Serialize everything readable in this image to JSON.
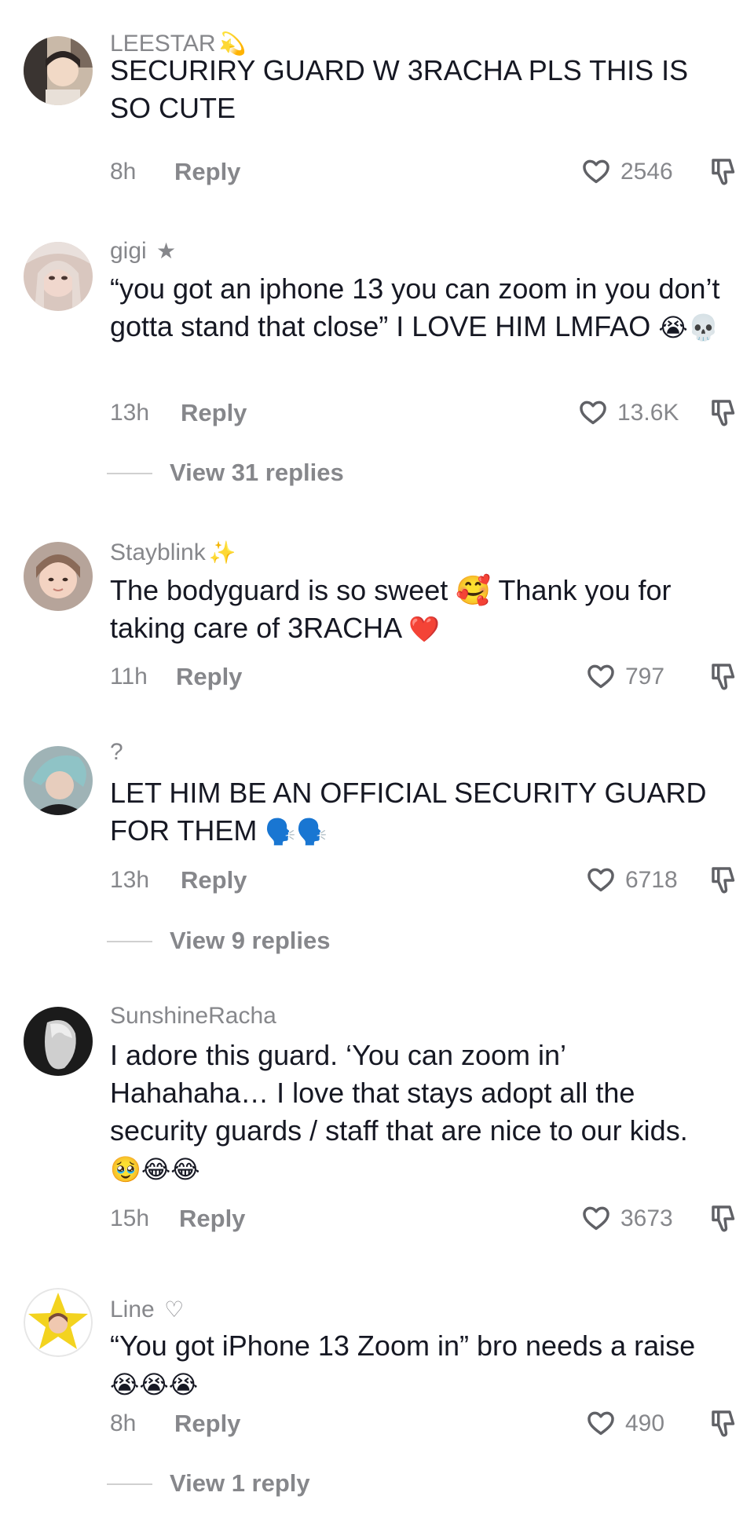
{
  "comments": [
    {
      "username": "LEESTAR",
      "username_deco": "💫",
      "text": "SECURIRY GUARD W 3RACHA PLS THIS IS SO CUTE",
      "time": "8h",
      "reply_label": "Reply",
      "likes": "2546"
    },
    {
      "username": "gigi",
      "username_deco": "★",
      "text": "“you got an iphone 13 you can zoom in you don’t gotta stand that close” I LOVE HIM LMFAO",
      "text_emoji": "😭💀",
      "time": "13h",
      "reply_label": "Reply",
      "likes": "13.6K",
      "view_replies": "View 31 replies"
    },
    {
      "username": "Stayblink",
      "username_deco": "✨",
      "text": "The bodyguard is so sweet 🥰 Thank you for taking care of 3RACHA",
      "text_emoji": "❤️",
      "time": "11h",
      "reply_label": "Reply",
      "likes": "797"
    },
    {
      "username": "?",
      "username_deco": "",
      "text": "LET HIM BE AN OFFICIAL SECURITY GUARD FOR THEM",
      "text_emoji": "🗣️🗣️",
      "time": "13h",
      "reply_label": "Reply",
      "likes": "6718",
      "view_replies": "View 9 replies"
    },
    {
      "username": "SunshineRacha",
      "username_deco": "",
      "text": "I adore this guard. ‘You can zoom in’ Hahahaha… I love that stays adopt all the security guards / staff that are nice to our kids.",
      "text_emoji": "🥹😂😂",
      "time": "15h",
      "reply_label": "Reply",
      "likes": "3673"
    },
    {
      "username": "Line",
      "username_deco": "♡",
      "text": "“You got iPhone 13 Zoom in” bro needs a raise",
      "text_emoji": "😭😭😭",
      "time": "8h",
      "reply_label": "Reply",
      "likes": "490",
      "view_replies": "View 1 reply"
    }
  ],
  "colors": {
    "text": "#161823",
    "secondary": "#86878b",
    "divider": "#d0d0d0",
    "heart_stroke": "#606166"
  },
  "icons": {
    "like": "heart-outline-icon",
    "dislike": "thumbs-down-icon"
  }
}
